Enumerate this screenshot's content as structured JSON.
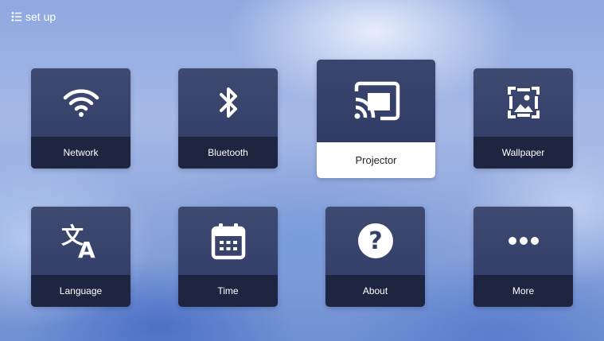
{
  "header": {
    "title": "set up"
  },
  "tiles": [
    {
      "label": "Network",
      "icon": "wifi-icon"
    },
    {
      "label": "Bluetooth",
      "icon": "bluetooth-icon"
    },
    {
      "label": "Projector",
      "icon": "cast-icon",
      "selected": true
    },
    {
      "label": "Wallpaper",
      "icon": "wallpaper-icon"
    },
    {
      "label": "Language",
      "icon": "translate-icon"
    },
    {
      "label": "Time",
      "icon": "calendar-icon"
    },
    {
      "label": "About",
      "icon": "help-icon"
    },
    {
      "label": "More",
      "icon": "more-icon"
    }
  ]
}
